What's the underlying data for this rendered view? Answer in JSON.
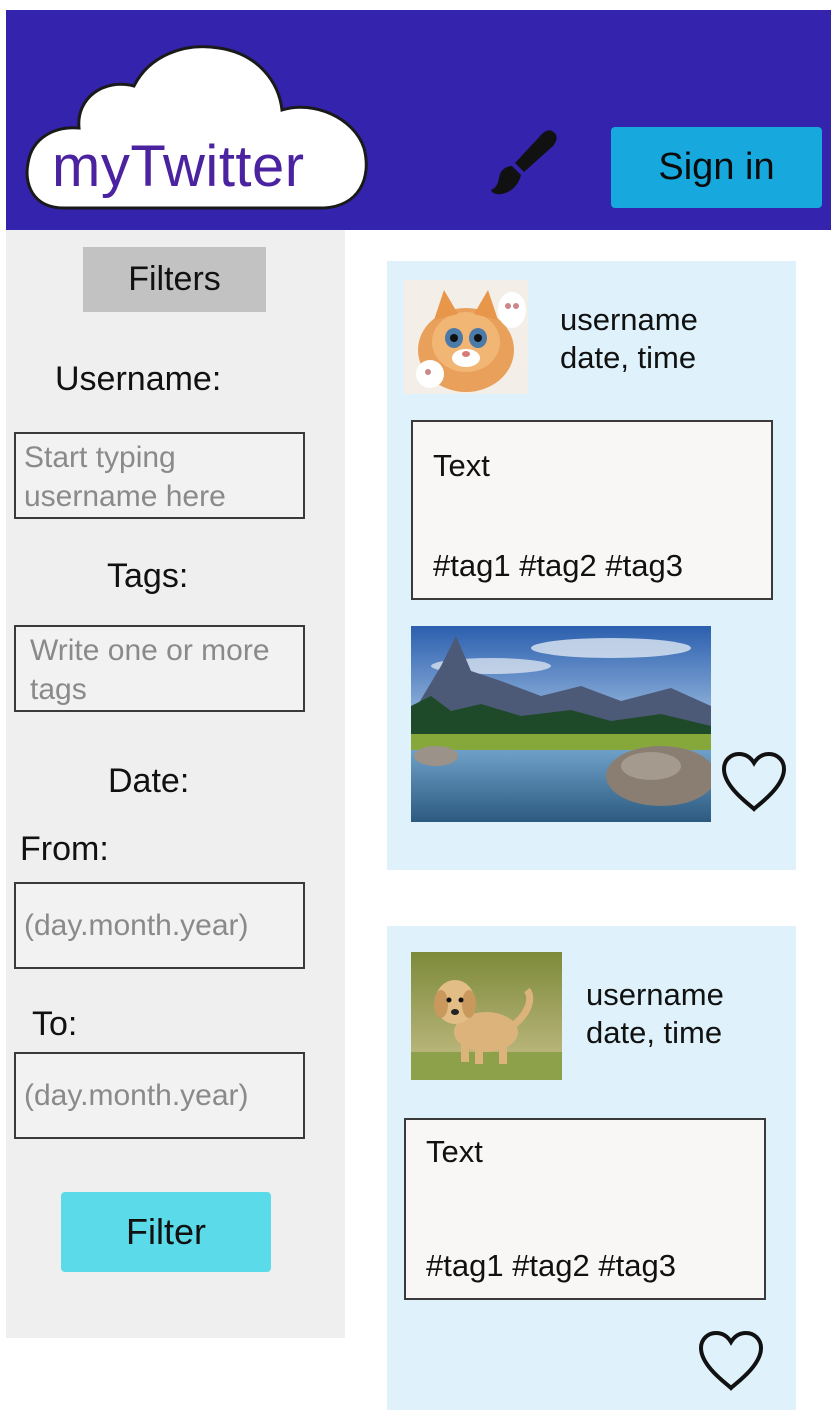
{
  "header": {
    "logo_text": "myTwitter",
    "brush_icon": "paintbrush-icon",
    "signin_label": "Sign in",
    "bg_color": "#3323ad",
    "signin_color": "#17a9dd"
  },
  "sidebar": {
    "title": "Filters",
    "username_label": "Username:",
    "username_placeholder": "Start typing username here",
    "tags_label": "Tags:",
    "tags_placeholder": "Write one or more tags",
    "date_label": "Date:",
    "from_label": "From:",
    "from_placeholder": "(day.month.year)",
    "to_label": "To:",
    "to_placeholder": "(day.month.year)",
    "filter_button": "Filter",
    "filter_button_color": "#5bdbea"
  },
  "posts": [
    {
      "avatar": "kitten-avatar",
      "username": "username",
      "datetime": "date, time",
      "text": "Text",
      "tags": "#tag1 #tag2 #tag3",
      "image": "mountain-lake-photo",
      "like_icon": "heart-icon"
    },
    {
      "avatar": "puppy-avatar",
      "username": "username",
      "datetime": "date, time",
      "text": "Text",
      "tags": "#tag1 #tag2 #tag3",
      "like_icon": "heart-icon"
    }
  ]
}
